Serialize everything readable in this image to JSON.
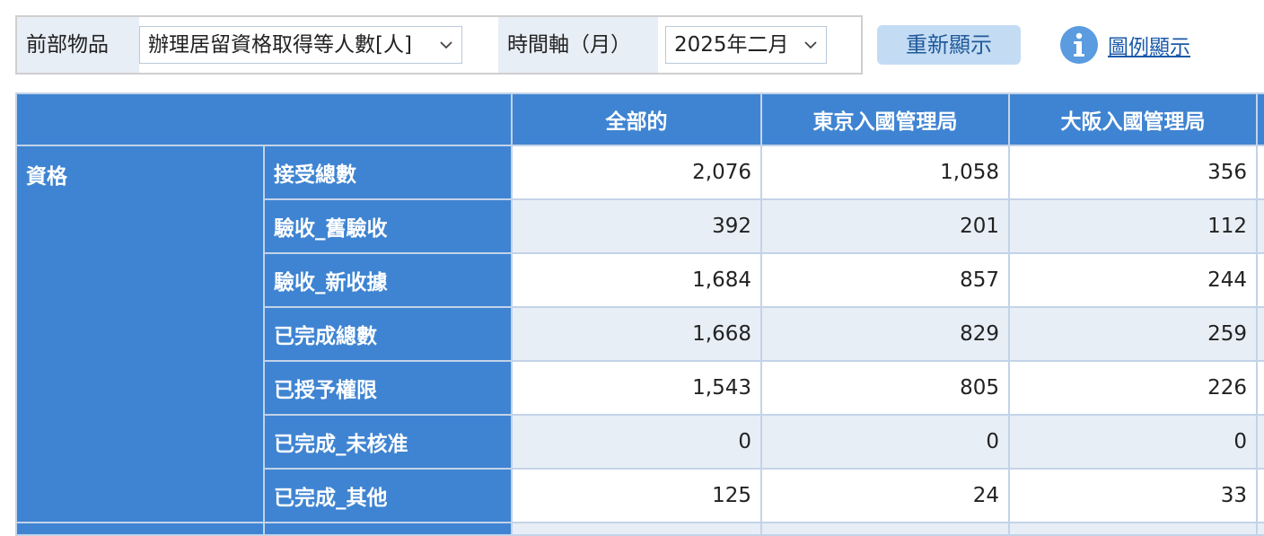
{
  "filters": {
    "item_label": "前部物品",
    "item_value": "辦理居留資格取得等人數[人]",
    "time_label": "時間軸（月）",
    "time_value": "2025年二月"
  },
  "actions": {
    "redisplay_label": "重新顯示",
    "legend_label": "圖例顯示"
  },
  "colors": {
    "header_blue": "#3f84d2",
    "row_stripe": "#e8eef6",
    "button_bg": "#c4dbf4",
    "link_blue": "#1a5aa8"
  },
  "table": {
    "columns": [
      "全部的",
      "東京入國管理局",
      "大阪入國管理局"
    ],
    "group_label": "資格",
    "rows": [
      {
        "label": "接受總數",
        "values": [
          "2,076",
          "1,058",
          "356"
        ]
      },
      {
        "label": "驗收_舊驗收",
        "values": [
          "392",
          "201",
          "112"
        ]
      },
      {
        "label": "驗收_新收據",
        "values": [
          "1,684",
          "857",
          "244"
        ]
      },
      {
        "label": "已完成總數",
        "values": [
          "1,668",
          "829",
          "259"
        ]
      },
      {
        "label": "已授予權限",
        "values": [
          "1,543",
          "805",
          "226"
        ]
      },
      {
        "label": "已完成_未核准",
        "values": [
          "0",
          "0",
          "0"
        ]
      },
      {
        "label": "已完成_其他",
        "values": [
          "125",
          "24",
          "33"
        ]
      }
    ]
  }
}
